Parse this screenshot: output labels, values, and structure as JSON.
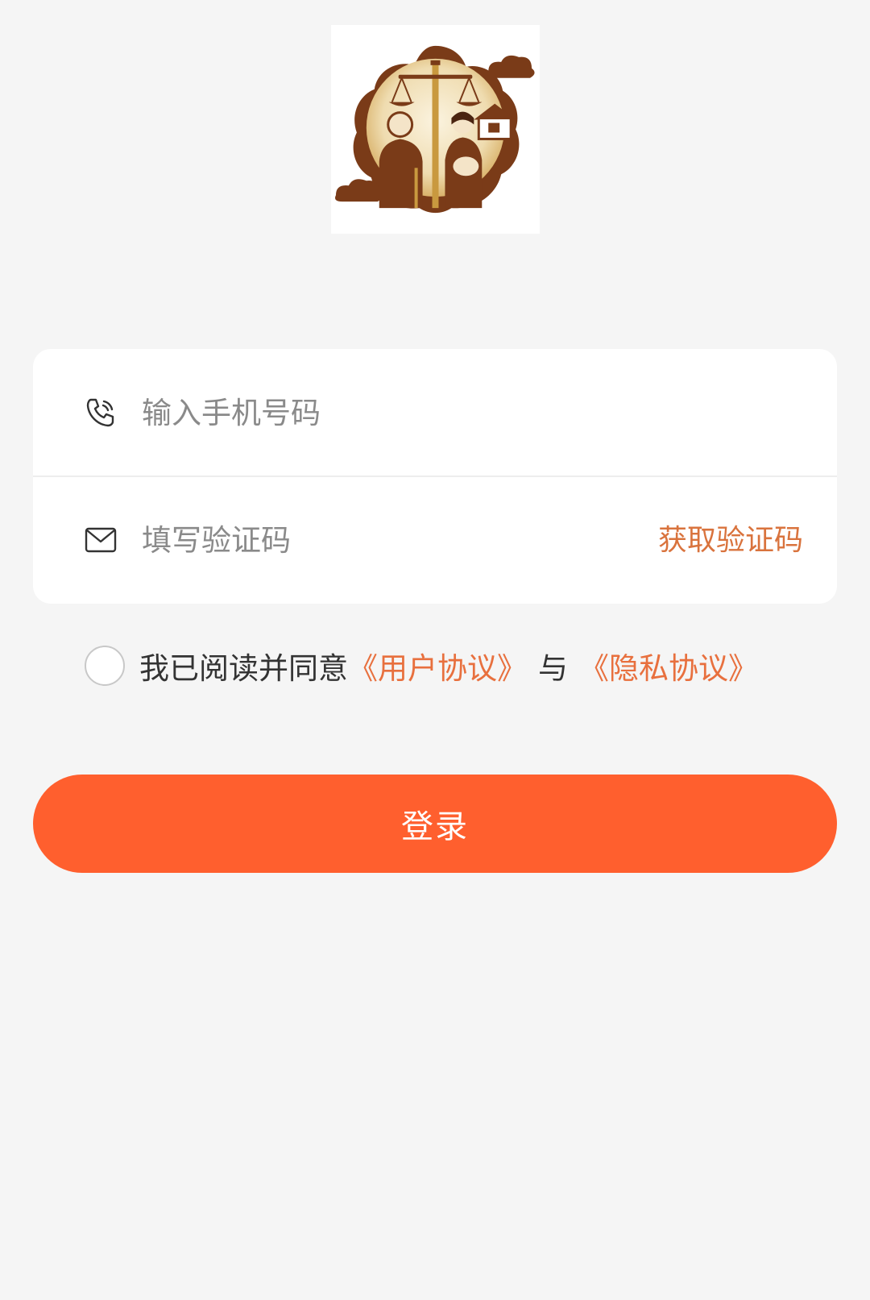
{
  "colors": {
    "page_background": "#f5f5f5",
    "card_background": "#ffffff",
    "accent_link": "#e8703e",
    "get_code_text": "#d9733d",
    "login_button": "#ff5f2e",
    "login_text": "#ffffff",
    "logo_brown": "#7a3b18",
    "logo_gold": "#c9993f"
  },
  "logo": {
    "icon": "family-justice-logo-icon"
  },
  "form": {
    "phone": {
      "icon": "phone-icon",
      "value": "",
      "placeholder": "输入手机号码"
    },
    "code": {
      "icon": "mail-icon",
      "value": "",
      "placeholder": "填写验证码",
      "get_code_label": "获取验证码"
    }
  },
  "agreement": {
    "checked": false,
    "prefix": "我已阅读并同意",
    "user_agreement": "《用户协议》",
    "separator": "与",
    "privacy_agreement": "《隐私协议》"
  },
  "login": {
    "label": "登录"
  }
}
